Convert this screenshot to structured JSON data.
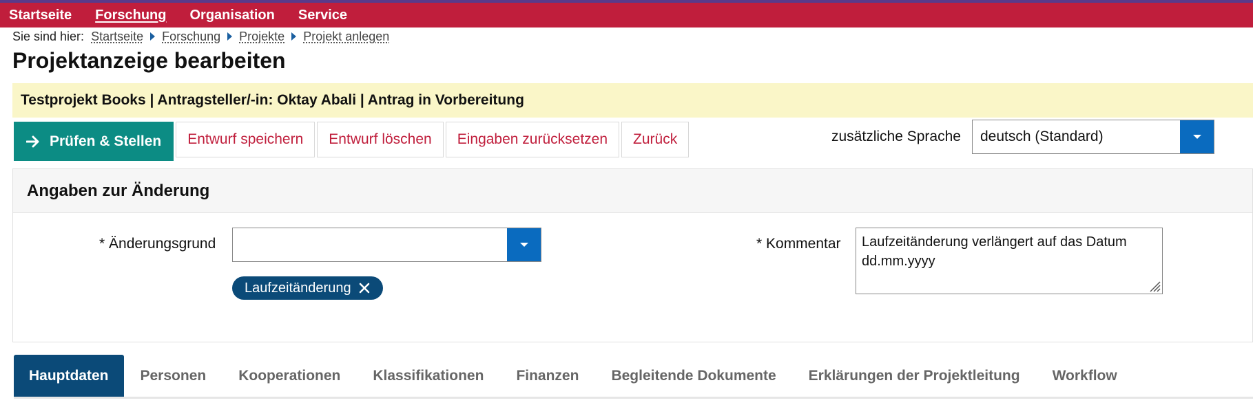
{
  "nav": {
    "items": [
      {
        "label": "Startseite",
        "active": false
      },
      {
        "label": "Forschung",
        "active": true
      },
      {
        "label": "Organisation",
        "active": false
      },
      {
        "label": "Service",
        "active": false
      }
    ]
  },
  "breadcrumb": {
    "label": "Sie sind hier:",
    "items": [
      "Startseite",
      "Forschung",
      "Projekte",
      "Projekt anlegen"
    ]
  },
  "page": {
    "title": "Projektanzeige bearbeiten"
  },
  "status": {
    "text": "Testprojekt Books | Antragsteller/-in: Oktay Abali | Antrag in Vorbereitung"
  },
  "toolbar": {
    "primary_label": "Prüfen & Stellen",
    "save_draft": "Entwurf speichern",
    "delete_draft": "Entwurf löschen",
    "reset": "Eingaben zurücksetzen",
    "back": "Zurück"
  },
  "language": {
    "label": "zusätzliche Sprache",
    "selected": "deutsch (Standard)"
  },
  "change_panel": {
    "title": "Angaben zur Änderung",
    "reason_label": "* Änderungsgrund",
    "reason_value": "",
    "reason_chip": "Laufzeitänderung",
    "comment_label": "* Kommentar",
    "comment_value": "Laufzeitänderung verlängert auf das Datum dd.mm.yyyy"
  },
  "tabs": [
    {
      "label": "Hauptdaten",
      "active": true
    },
    {
      "label": "Personen"
    },
    {
      "label": "Kooperationen"
    },
    {
      "label": "Klassifikationen"
    },
    {
      "label": "Finanzen"
    },
    {
      "label": "Begleitende Dokumente"
    },
    {
      "label": "Erklärungen der Projektleitung"
    },
    {
      "label": "Workflow"
    }
  ],
  "colors": {
    "nav_bg": "#c01e3c",
    "primary_button": "#0c8c84",
    "select_button": "#0a6bbf",
    "active_tab": "#0b4a78",
    "status_bg": "#faf6c8"
  },
  "icons": [
    "arrow-right-icon",
    "chevron-down-icon",
    "close-icon",
    "resize-grip-icon"
  ]
}
